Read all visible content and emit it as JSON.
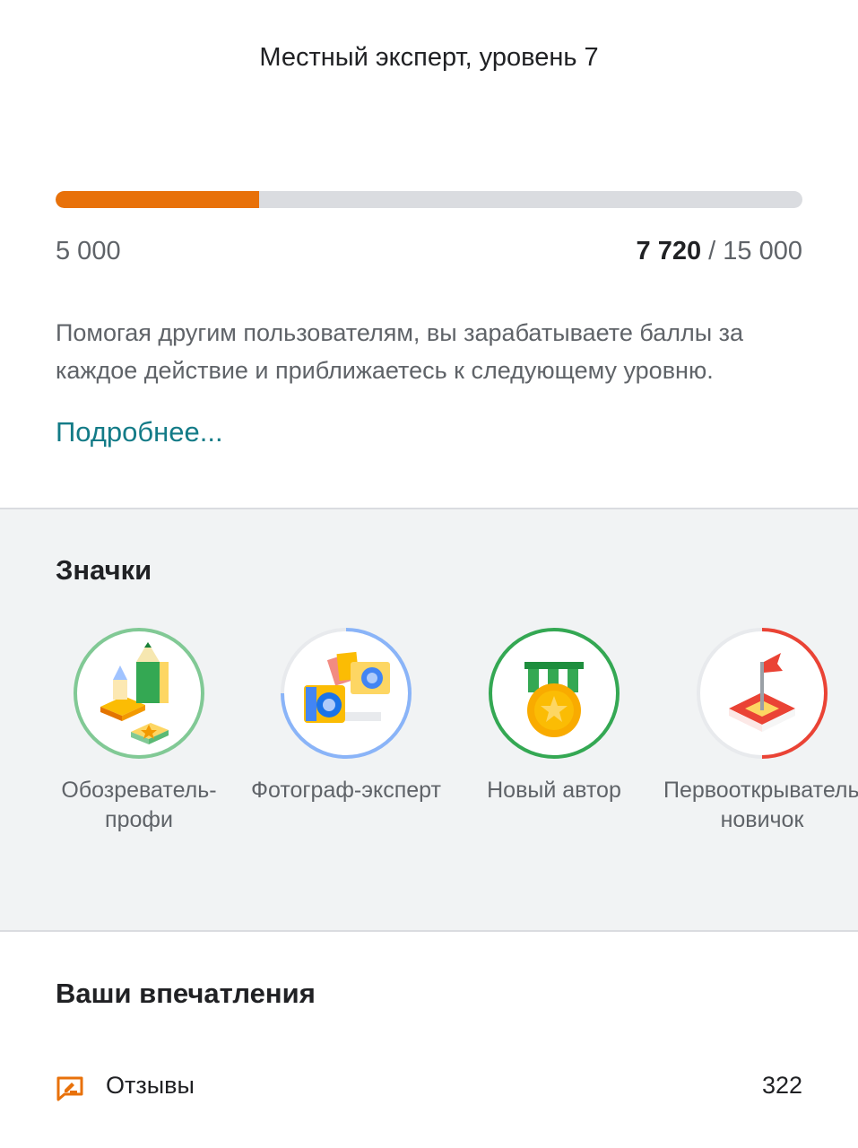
{
  "header": {
    "title": "Местный эксперт, уровень 7"
  },
  "progress": {
    "fraction": 0.272,
    "range_min": "5 000",
    "current": "7 720",
    "separator": " / ",
    "target": "15 000",
    "fill_color": "#e8710a"
  },
  "description": "Помогая другим пользователям, вы зарабатываете баллы за каждое действие и приближаетесь к следующему уровню.",
  "more_link": "Подробнее...",
  "badges": {
    "title": "Значки",
    "items": [
      {
        "label": "Обозреватель-профи",
        "icon": "pencil-blocks-icon",
        "ring_color": "#81c995"
      },
      {
        "label": "Фотограф-эксперт",
        "icon": "cameras-icon",
        "ring_color": "#8ab4f8"
      },
      {
        "label": "Новый автор",
        "icon": "medal-icon",
        "ring_color": "#34a853"
      },
      {
        "label": "Первооткрыватель-новичок",
        "icon": "flag-icon",
        "ring_color": "#ea4335"
      }
    ]
  },
  "impressions": {
    "title": "Ваши впечатления",
    "items": [
      {
        "label": "Отзывы",
        "value": "322",
        "icon": "review-icon"
      }
    ]
  }
}
